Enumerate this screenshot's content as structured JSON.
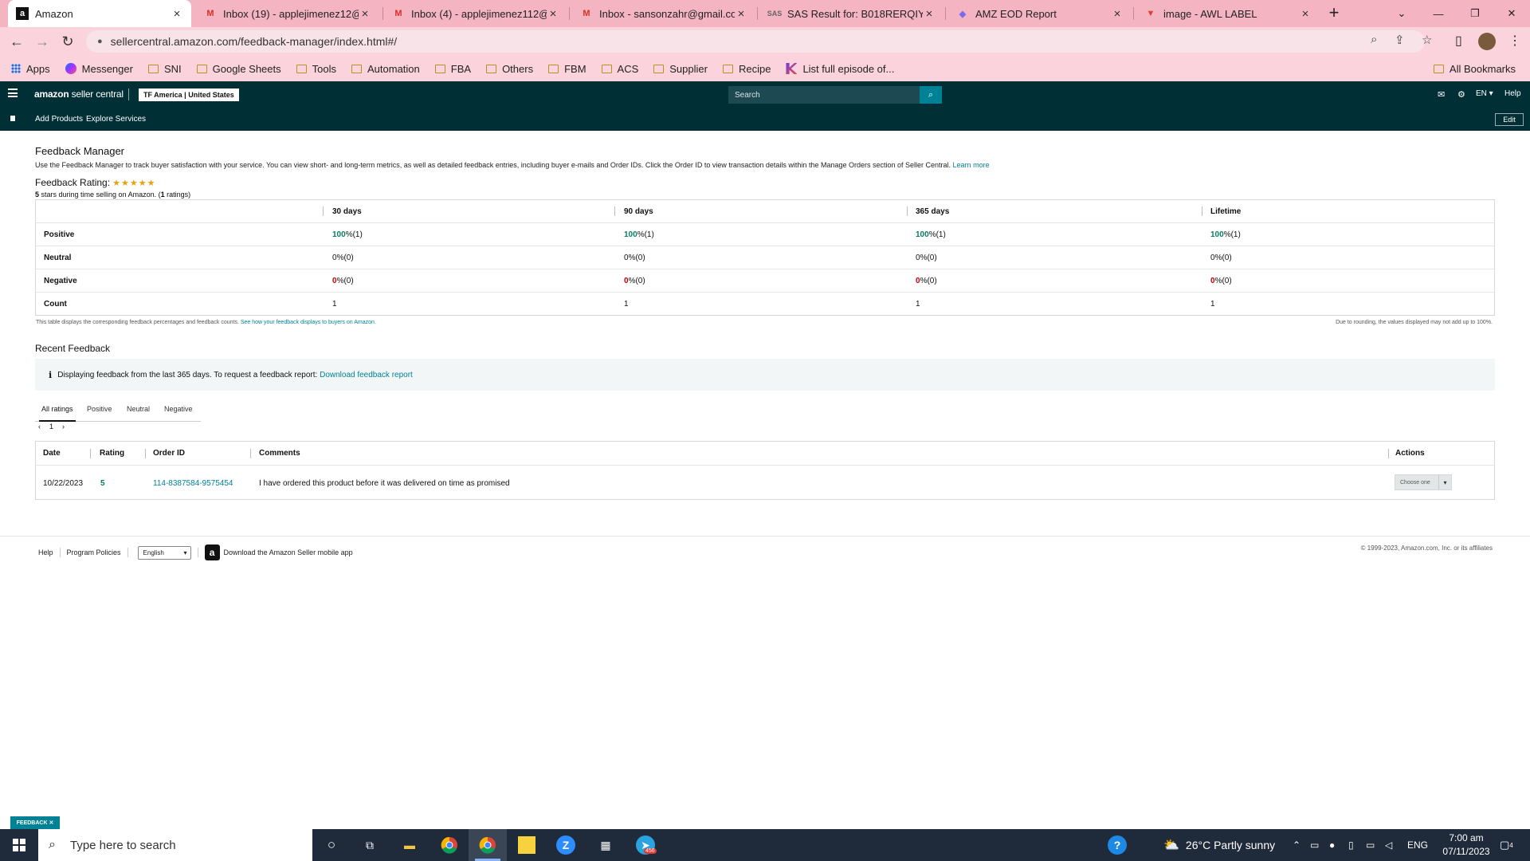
{
  "browser": {
    "tabs": [
      {
        "title": "Amazon",
        "icon": "amazon-favicon"
      },
      {
        "title": "Inbox (19) - applejimenez12@g",
        "icon": "gmail-icon"
      },
      {
        "title": "Inbox (4) - applejimenez112@g",
        "icon": "gmail-icon"
      },
      {
        "title": "Inbox - sansonzahr@gmail.com",
        "icon": "gmail-icon"
      },
      {
        "title": "SAS Result for: B018RERQIY",
        "icon": "sas-icon"
      },
      {
        "title": "AMZ EOD Report",
        "icon": "clickup-icon"
      },
      {
        "title": "image - AWL LABEL",
        "icon": "todoist-icon"
      }
    ],
    "url": "sellercentral.amazon.com/feedback-manager/index.html#/",
    "bookmarks": [
      "Apps",
      "Messenger",
      "SNI",
      "Google Sheets",
      "Tools",
      "Automation",
      "FBA",
      "Others",
      "FBM",
      "ACS",
      "Supplier",
      "Recipe",
      "List full episode of..."
    ],
    "all_bookmarks": "All Bookmarks"
  },
  "header": {
    "logo_bold": "amazon",
    "logo_thin": " seller central",
    "account": "TF America | United States",
    "search_placeholder": "Search",
    "lang": "EN ▾",
    "help": "Help",
    "nav": [
      "Add Products",
      "Explore Services"
    ],
    "edit": "Edit"
  },
  "page": {
    "title": "Feedback Manager",
    "description": "Use the Feedback Manager to track buyer satisfaction with your service. You can view short- and long-term metrics, as well as detailed feedback entries, including buyer e-mails and Order IDs. Click the Order ID to view transaction details within the Manage Orders section of Seller Central.",
    "learn_more": "Learn more",
    "rating_label": "Feedback Rating:",
    "rating_stars": 5,
    "rating_sub_value": "5",
    "rating_sub_text": " stars during time selling on Amazon. (",
    "rating_count": "1",
    "rating_sub_end": " ratings)"
  },
  "metrics": {
    "columns": [
      "30 days",
      "90 days",
      "365 days",
      "Lifetime"
    ],
    "rows": [
      {
        "label": "Positive",
        "cells": [
          [
            "100",
            " %(1)"
          ],
          [
            "100",
            " %(1)"
          ],
          [
            "100",
            " %(1)"
          ],
          [
            "100",
            " %(1)"
          ]
        ],
        "tone": "green"
      },
      {
        "label": "Neutral",
        "cells": [
          [
            "0",
            " %(0)"
          ],
          [
            "0",
            " %(0)"
          ],
          [
            "0",
            " %(0)"
          ],
          [
            "0",
            " %(0)"
          ]
        ],
        "tone": "plain"
      },
      {
        "label": "Negative",
        "cells": [
          [
            "0",
            " %(0)"
          ],
          [
            "0",
            " %(0)"
          ],
          [
            "0",
            " %(0)"
          ],
          [
            "0",
            " %(0)"
          ]
        ],
        "tone": "red"
      },
      {
        "label": "Count",
        "cells": [
          [
            "1",
            ""
          ],
          [
            "1",
            ""
          ],
          [
            "1",
            ""
          ],
          [
            "1",
            ""
          ]
        ],
        "tone": "plain"
      }
    ],
    "note_left": "This table displays the corresponding feedback percentages and feedback counts.",
    "note_left_link": "See how your feedback displays to buyers on Amazon.",
    "note_right": "Due to rounding, the values displayed may not add up to 100%."
  },
  "recent": {
    "title": "Recent Feedback",
    "alert_text": "Displaying feedback from the last 365 days. To request a feedback report:",
    "alert_link": "Download feedback report",
    "tabs": [
      "All ratings",
      "Positive",
      "Neutral",
      "Negative"
    ],
    "page": "1",
    "columns": [
      "Date",
      "Rating",
      "Order ID",
      "Comments",
      "Actions"
    ],
    "rows": [
      {
        "date": "10/22/2023",
        "rating": "5",
        "order_id": "114-8387584-9575454",
        "comment": "I have ordered this product before it was delivered on time as promised",
        "action": "Choose one"
      }
    ]
  },
  "footer": {
    "help": "Help",
    "policies": "Program Policies",
    "language": "English",
    "app_text": "Download the Amazon Seller mobile app",
    "copyright": "© 1999-2023, Amazon.com, Inc. or its affiliates",
    "feedback_tab": "FEEDBACK ✕"
  },
  "taskbar": {
    "search_placeholder": "Type here to search",
    "weather": "26°C  Partly sunny",
    "lang": "ENG",
    "time": "7:00 am",
    "date": "07/11/2023",
    "telegram_badge": "456",
    "notifications": "4"
  },
  "colors": {
    "accent": "#008296",
    "header_bg": "#002f36",
    "tab_strip": "#f4b4c2",
    "positive": "#067d62",
    "negative": "#c40000"
  }
}
